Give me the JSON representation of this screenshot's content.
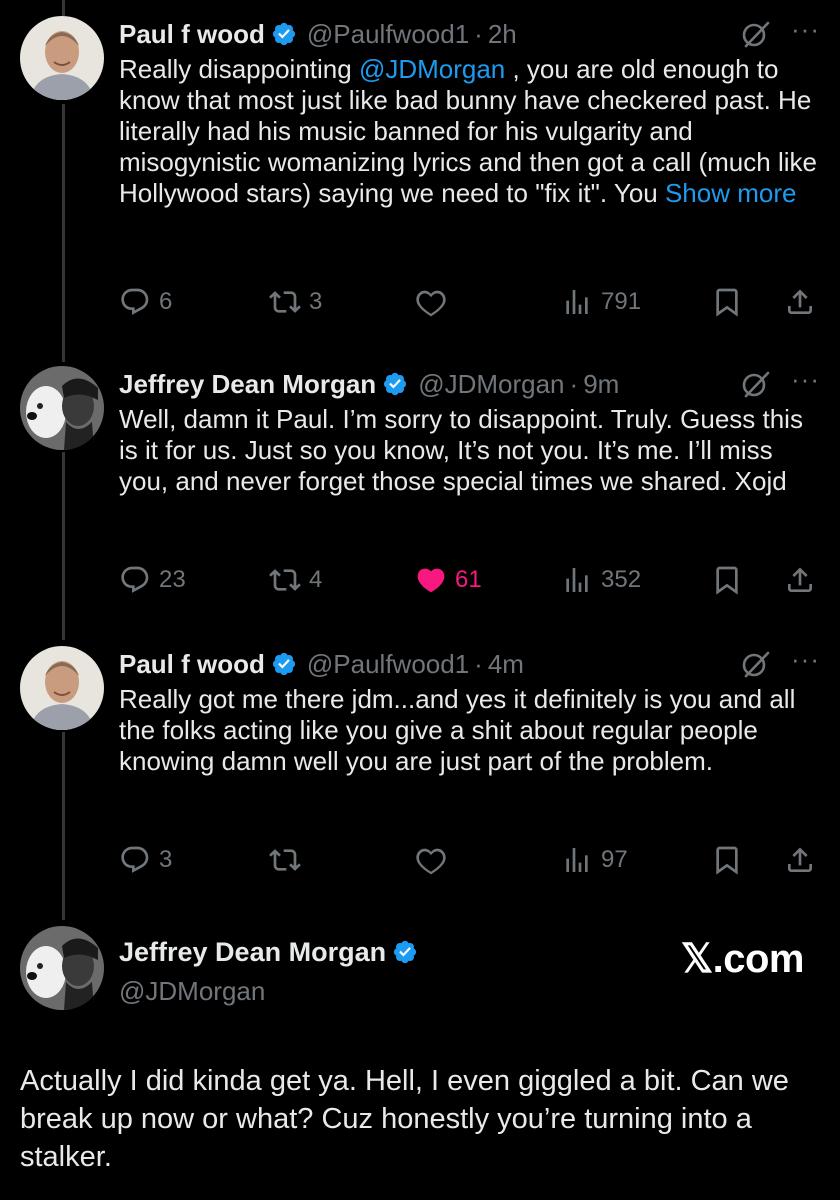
{
  "tweets": [
    {
      "name": "Paul f wood",
      "handle": "@Paulfwood1",
      "time": "2h",
      "text_before": "Really disappointing ",
      "mention": "@JDMorgan",
      "text_after": " , you are old enough to know that most just like bad bunny have checkered past. He literally had his music banned for his vulgarity and misogynistic womanizing lyrics and then got a call (much like Hollywood stars) saying we need to \"fix it\". You ",
      "show_more": "Show more",
      "replies": "6",
      "reposts": "3",
      "likes": "",
      "views": "791"
    },
    {
      "name": "Jeffrey Dean Morgan",
      "handle": "@JDMorgan",
      "time": "9m",
      "text": "Well, damn it Paul. I’m sorry to disappoint. Truly. Guess this is it for us. Just so you know, It’s not you. It’s me. I’ll miss you, and never forget those special times we shared. Xojd",
      "replies": "23",
      "reposts": "4",
      "likes": "61",
      "views": "352"
    },
    {
      "name": "Paul f wood",
      "handle": "@Paulfwood1",
      "time": "4m",
      "text": "Really got me there jdm...and yes it definitely is you and all the folks acting like you give a shit about regular people knowing damn well you are just part of the problem.",
      "replies": "3",
      "reposts": "",
      "likes": "",
      "views": "97"
    }
  ],
  "final": {
    "name": "Jeffrey Dean Morgan",
    "handle": "@JDMorgan",
    "brand": "𝕏.com",
    "text": "Actually I did kinda get ya. Hell, I even giggled a bit. Can we break up now or what? Cuz honestly you’re turning into a stalker."
  },
  "dot": "·",
  "more_glyph": "···",
  "colors": {
    "accent": "#1d9bf0",
    "like": "#f91880",
    "muted": "#71767b",
    "text": "#e7e9ea",
    "background": "#000000"
  },
  "icons": [
    "verified-badge-icon",
    "grok-icon",
    "more-icon",
    "reply-icon",
    "repost-icon",
    "like-icon",
    "views-icon",
    "bookmark-icon",
    "share-icon"
  ]
}
